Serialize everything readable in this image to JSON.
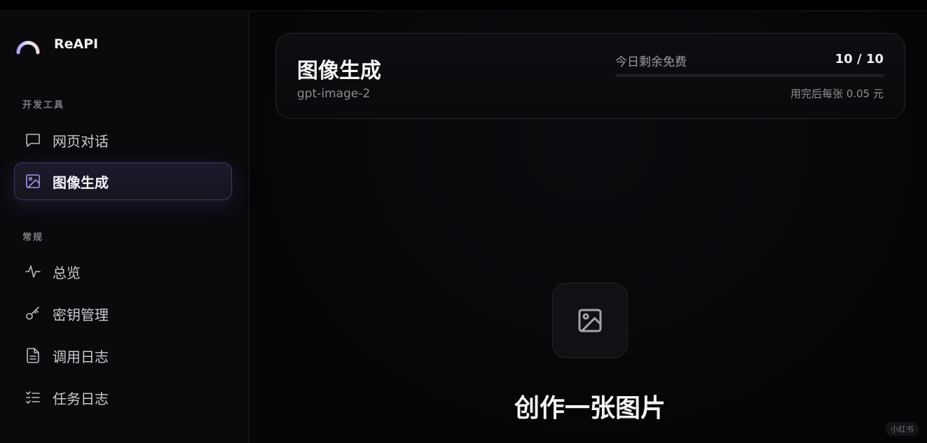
{
  "brand": {
    "name": "ReAPI",
    "logo_icon": "arc-logo-icon"
  },
  "sidebar": {
    "sections": [
      {
        "label": "开发工具",
        "items": [
          {
            "label": "网页对话",
            "icon": "chat-bubble-icon",
            "active": false
          },
          {
            "label": "图像生成",
            "icon": "image-icon",
            "active": true
          }
        ]
      },
      {
        "label": "常规",
        "items": [
          {
            "label": "总览",
            "icon": "activity-icon",
            "active": false
          },
          {
            "label": "密钥管理",
            "icon": "key-icon",
            "active": false
          },
          {
            "label": "调用日志",
            "icon": "document-icon",
            "active": false
          },
          {
            "label": "任务日志",
            "icon": "task-list-icon",
            "active": false
          }
        ]
      }
    ]
  },
  "header_card": {
    "title": "图像生成",
    "model": "gpt-image-2",
    "quota_label": "今日剩余免费",
    "quota_count": "10 / 10",
    "quota_fraction": 1.0,
    "price_note": "用完后每张 0.05 元"
  },
  "empty_state": {
    "icon": "image-icon",
    "title": "创作一张图片"
  },
  "watermark": "小红书",
  "colors": {
    "accent": "#9d97f0",
    "background": "#050507",
    "active_border": "#3b3a5c"
  }
}
